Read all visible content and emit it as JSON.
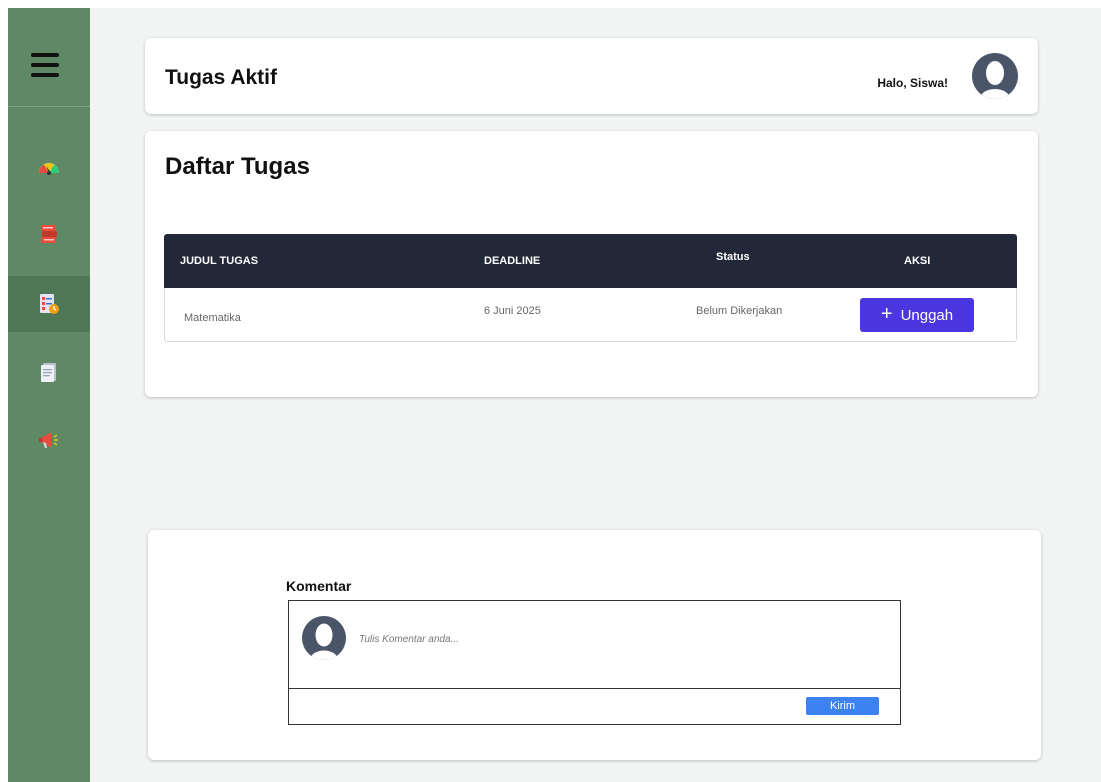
{
  "header": {
    "title": "Tugas Aktif",
    "greeting": "Halo, Siswa!"
  },
  "sidebar": {
    "items": [
      {
        "icon": "dashboard-gauge-icon",
        "active": false
      },
      {
        "icon": "books-icon",
        "active": false
      },
      {
        "icon": "task-list-icon",
        "active": true
      },
      {
        "icon": "document-icon",
        "active": false
      },
      {
        "icon": "megaphone-icon",
        "active": false
      }
    ]
  },
  "tasks": {
    "title": "Daftar Tugas",
    "columns": [
      "JUDUL TUGAS",
      "DEADLINE",
      "Status",
      "AKSI"
    ],
    "rows": [
      {
        "title": "Matematika",
        "deadline": "6 Juni 2025",
        "status": "Belum Dikerjakan",
        "action": "Unggah"
      }
    ]
  },
  "comments": {
    "title": "Komentar",
    "placeholder": "Tulis Komentar anda...",
    "send_label": "Kirim"
  },
  "colors": {
    "sidebar": "#5e8964",
    "table_header": "#232838",
    "upload_button": "#4a37e0",
    "send_button": "#3d82f0"
  }
}
